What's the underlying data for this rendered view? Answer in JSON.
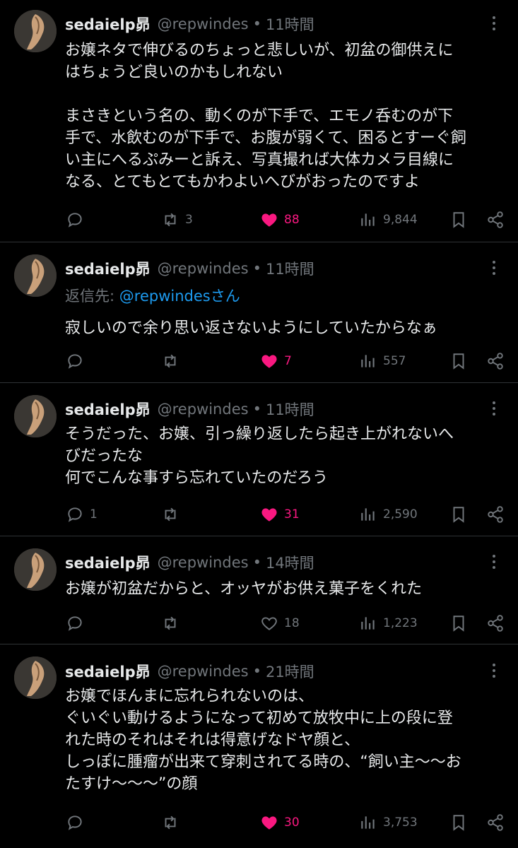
{
  "colors": {
    "background": "#000000",
    "text": "#e7e9ea",
    "muted": "#71767b",
    "like": "#f91880",
    "link": "#1d9bf0",
    "divider": "#2f3336"
  },
  "icons": {
    "reply": "speech-bubble-icon",
    "retweet": "retweet-arrows-icon",
    "like": "heart-icon",
    "views": "bar-chart-icon",
    "bookmark": "bookmark-icon",
    "share": "share-nodes-icon",
    "more": "vertical-dots-icon"
  },
  "tweets": [
    {
      "name": "sedaielp昴",
      "handle": "@repwindes",
      "dot": "•",
      "time": "11時間",
      "lines": [
        "お嬢ネタで伸びるのちょっと悲しいが、初盆の御供えに",
        "はちょうど良いのかもしれない",
        "",
        "まさきという名の、動くのが下手で、エモノ呑むのが下",
        "手で、水飲むのが下手で、お腹が弱くて、困るとすーぐ飼",
        "い主にへるぷみーと訴え、写真撮れば大体カメラ目線に",
        "なる、とてもとてもかわよいへびがおったのですよ"
      ],
      "replies": "",
      "retweets": "3",
      "likes": "88",
      "liked": true,
      "views": "9,844"
    },
    {
      "name": "sedaielp昴",
      "handle": "@repwindes",
      "dot": "•",
      "time": "11時間",
      "reply_prefix": "返信先: ",
      "reply_link": "@repwindesさん",
      "lines": [
        "寂しいので余り思い返さないようにしていたからなぁ"
      ],
      "replies": "",
      "retweets": "",
      "likes": "7",
      "liked": true,
      "views": "557"
    },
    {
      "name": "sedaielp昴",
      "handle": "@repwindes",
      "dot": "•",
      "time": "11時間",
      "lines": [
        "そうだった、お嬢、引っ繰り返したら起き上がれないへ",
        "びだったな",
        "何でこんな事すら忘れていたのだろう"
      ],
      "replies": "1",
      "retweets": "",
      "likes": "31",
      "liked": true,
      "views": "2,590"
    },
    {
      "name": "sedaielp昴",
      "handle": "@repwindes",
      "dot": "•",
      "time": "14時間",
      "lines": [
        "お嬢が初盆だからと、オッヤがお供え菓子をくれた"
      ],
      "replies": "",
      "retweets": "",
      "likes": "18",
      "liked": false,
      "views": "1,223"
    },
    {
      "name": "sedaielp昴",
      "handle": "@repwindes",
      "dot": "•",
      "time": "21時間",
      "lines": [
        "お嬢でほんまに忘れられないのは、",
        "ぐいぐい動けるようになって初めて放牧中に上の段に登",
        "れた時のそれはそれは得意げなドヤ顔と、",
        "しっぽに腫瘤が出来て穿刺されてる時の、“飼い主〜〜お",
        "たすけ〜〜〜”の顔"
      ],
      "replies": "",
      "retweets": "",
      "likes": "30",
      "liked": true,
      "views": "3,753"
    }
  ]
}
